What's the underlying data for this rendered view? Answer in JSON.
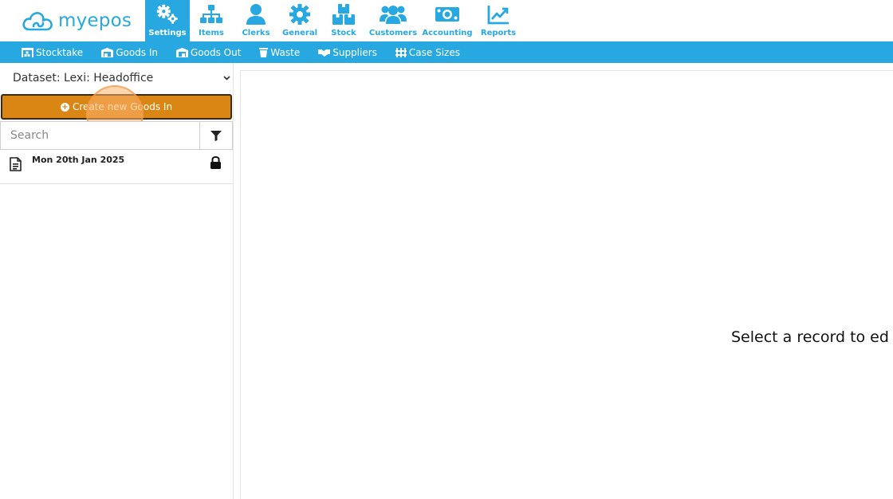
{
  "brand": {
    "name": "myepos"
  },
  "nav": {
    "items": [
      {
        "label": "Settings",
        "icon": "gears-icon",
        "active": true
      },
      {
        "label": "Items",
        "icon": "sitemap-icon"
      },
      {
        "label": "Clerks",
        "icon": "user-icon"
      },
      {
        "label": "General",
        "icon": "gear-icon"
      },
      {
        "label": "Stock",
        "icon": "boxes-icon"
      },
      {
        "label": "Customers",
        "icon": "users-icon"
      },
      {
        "label": "Accounting",
        "icon": "money-icon"
      },
      {
        "label": "Reports",
        "icon": "chart-line-icon"
      }
    ]
  },
  "subnav": {
    "items": [
      {
        "label": "Stocktake",
        "icon": "warehouse-icon"
      },
      {
        "label": "Goods In",
        "icon": "truck-in-icon"
      },
      {
        "label": "Goods Out",
        "icon": "truck-out-icon"
      },
      {
        "label": "Waste",
        "icon": "trash-icon"
      },
      {
        "label": "Suppliers",
        "icon": "handshake-icon"
      },
      {
        "label": "Case Sizes",
        "icon": "pallet-icon"
      }
    ]
  },
  "sidebar": {
    "dataset_label": "Dataset: Lexi: Headoffice",
    "create_button": "Create new Goods In",
    "search_placeholder": "Search",
    "records": [
      {
        "label": "Mon 20th Jan 2025",
        "locked": true
      }
    ]
  },
  "main": {
    "empty_message": "Select a record to ed"
  },
  "colors": {
    "accent": "#27a8e0",
    "create_button": "#d98614"
  }
}
